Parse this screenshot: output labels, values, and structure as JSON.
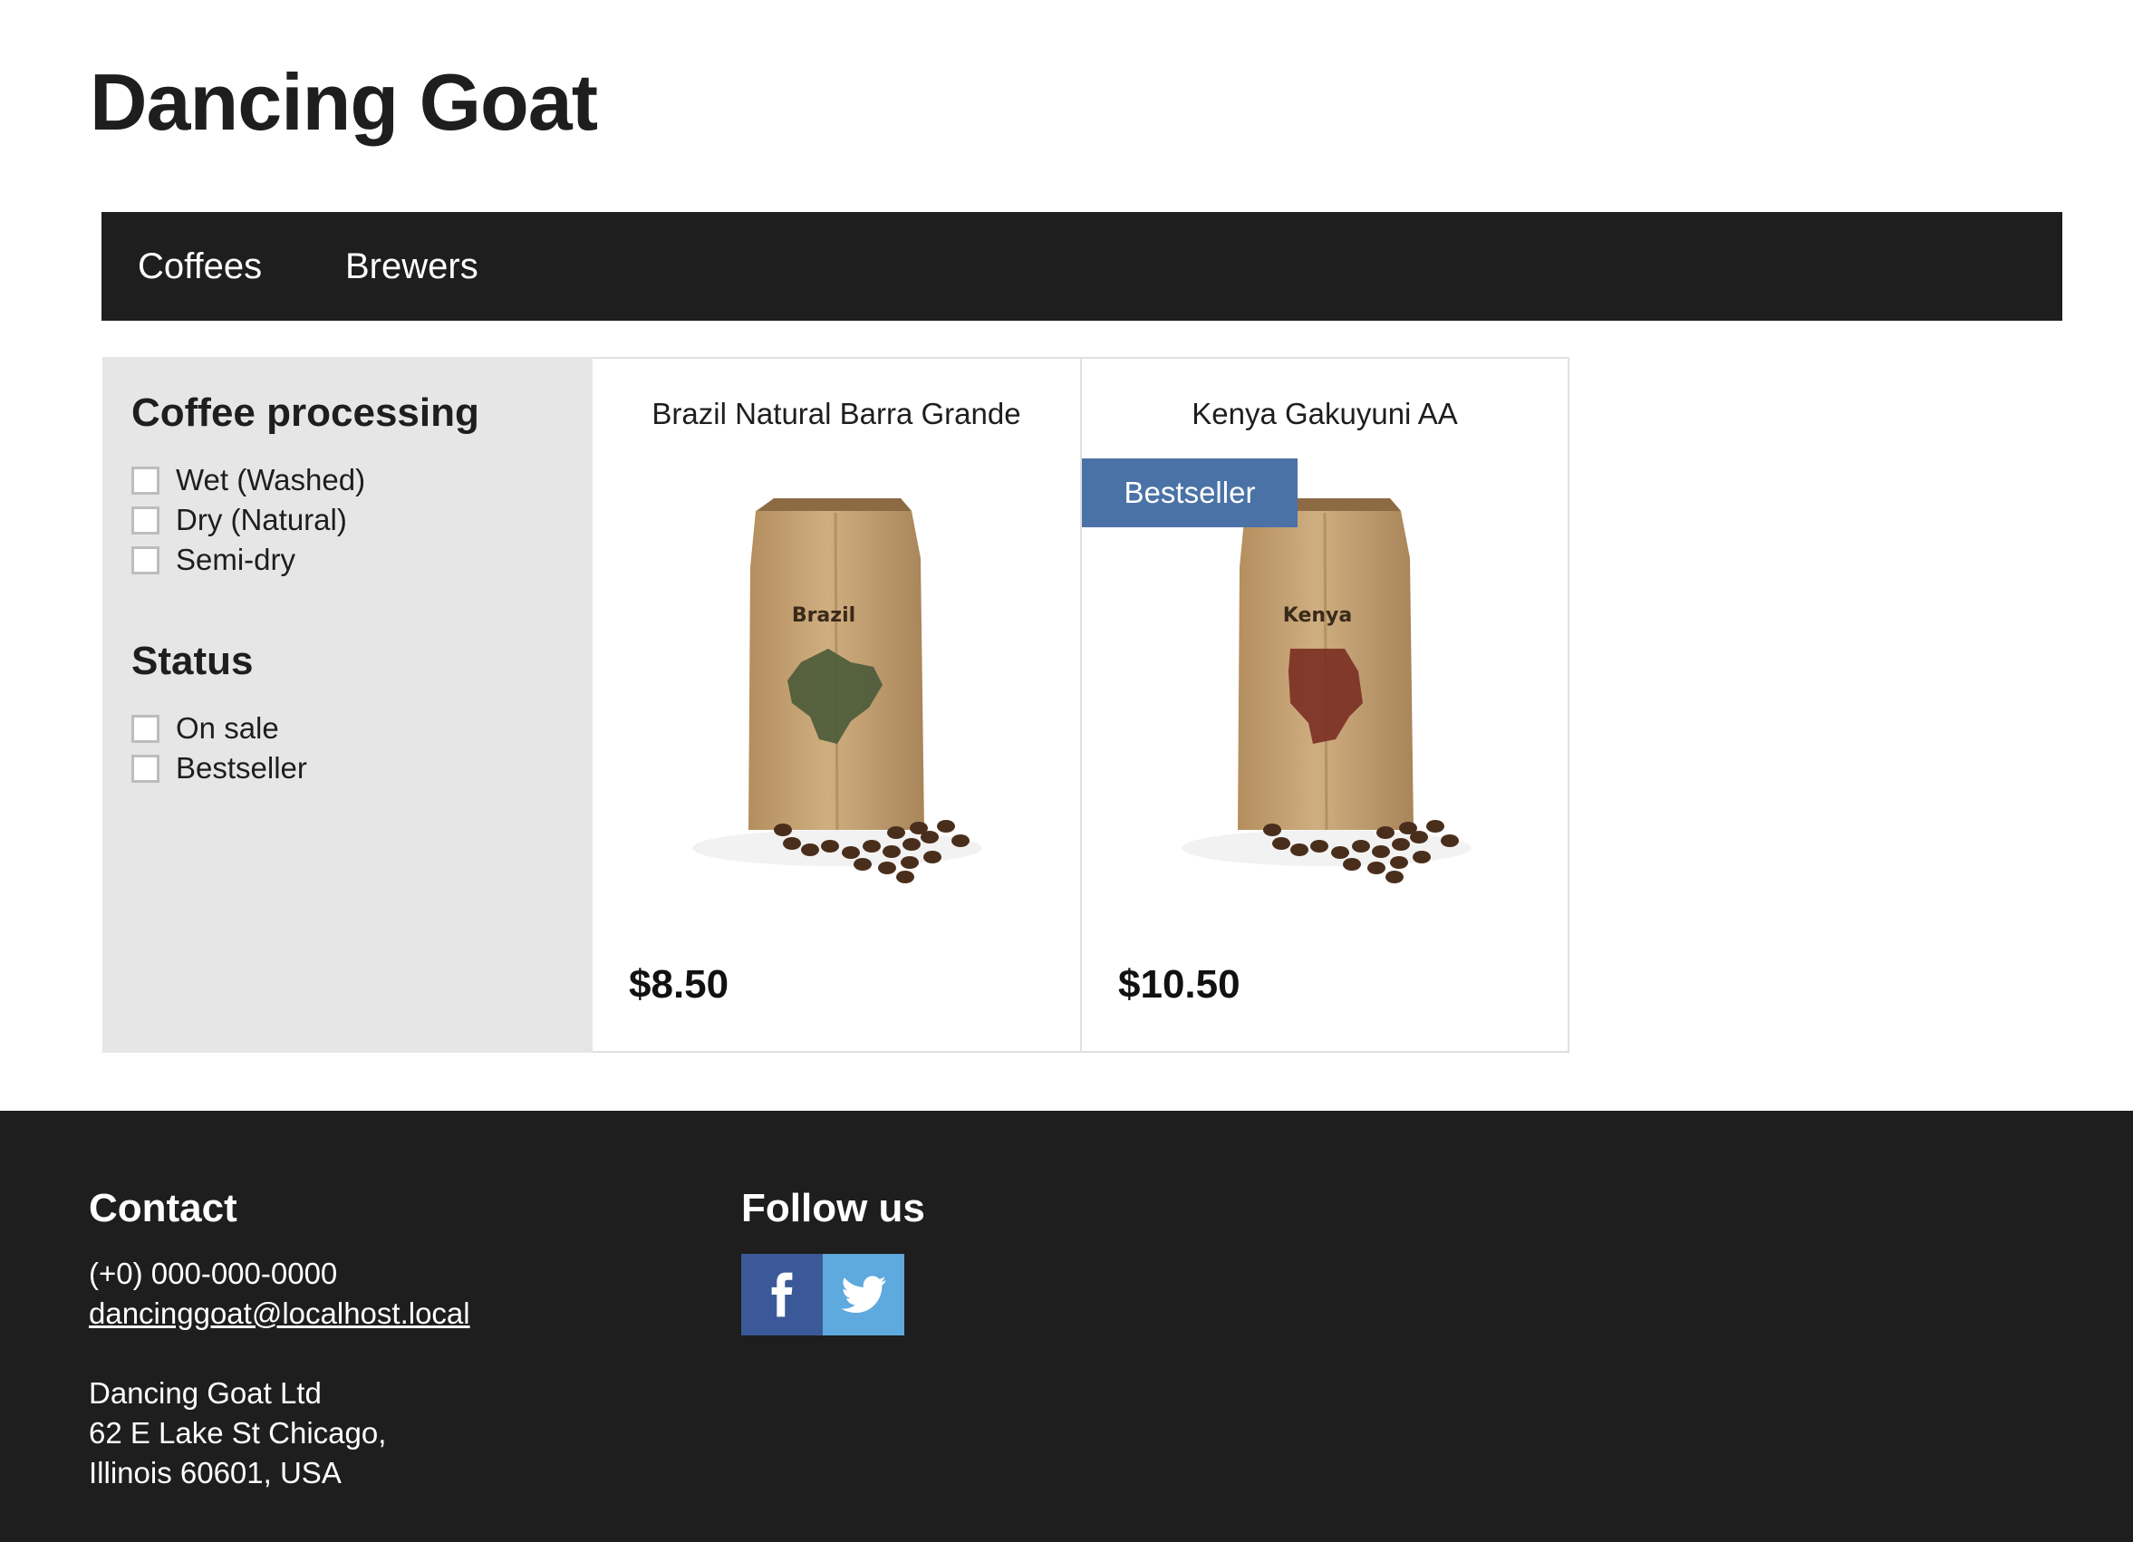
{
  "site": {
    "title": "Dancing Goat"
  },
  "nav": {
    "items": [
      {
        "label": "Coffees"
      },
      {
        "label": "Brewers"
      }
    ]
  },
  "filters": {
    "processing": {
      "heading": "Coffee processing",
      "options": [
        {
          "label": "Wet (Washed)",
          "checked": false
        },
        {
          "label": "Dry (Natural)",
          "checked": false
        },
        {
          "label": "Semi-dry",
          "checked": false
        }
      ]
    },
    "status": {
      "heading": "Status",
      "options": [
        {
          "label": "On sale",
          "checked": false
        },
        {
          "label": "Bestseller",
          "checked": false
        }
      ]
    }
  },
  "products": [
    {
      "name": "Brazil Natural Barra Grande",
      "bag_label": "Brazil",
      "map_color": "#4a5a38",
      "price": "$8.50",
      "badge": ""
    },
    {
      "name": "Kenya Gakuyuni AA",
      "bag_label": "Kenya",
      "map_color": "#7a2e22",
      "price": "$10.50",
      "badge": "Bestseller"
    }
  ],
  "footer": {
    "contact": {
      "heading": "Contact",
      "phone": "(+0) 000-000-0000",
      "email": "dancinggoat@localhost.local",
      "company": "Dancing Goat Ltd",
      "address_line1": "62 E Lake St Chicago,",
      "address_line2": "Illinois 60601, USA"
    },
    "follow": {
      "heading": "Follow us",
      "networks": [
        "facebook-icon",
        "twitter-icon"
      ]
    }
  },
  "colors": {
    "dark": "#1e1e1e",
    "badge": "#4a72a6",
    "filter_bg": "#e6e6e6",
    "facebook": "#3b5998",
    "twitter": "#5ea9dd"
  }
}
